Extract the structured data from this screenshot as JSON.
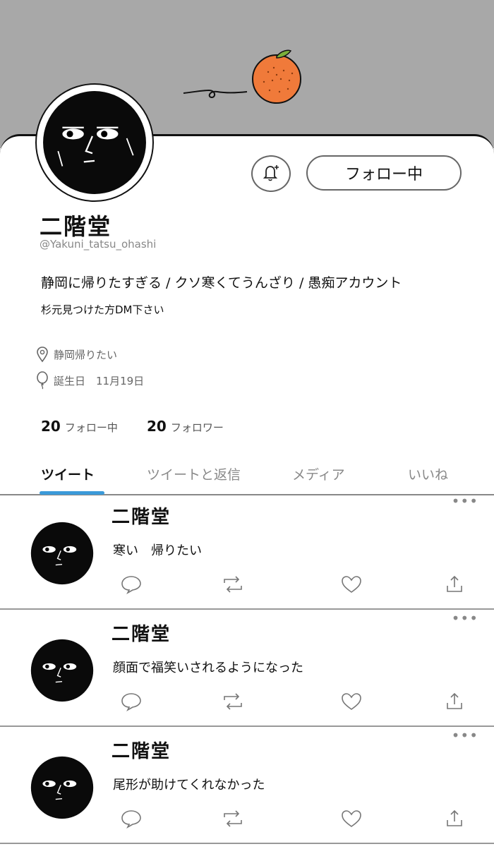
{
  "profile": {
    "name": "二階堂",
    "handle": "@Yakuni_tatsu_ohashi",
    "bio_line1": "静岡に帰りたすぎる / クソ寒くてうんざり / 愚痴アカウント",
    "bio_line2": "杉元見つけた方DM下さい",
    "location": "静岡帰りたい",
    "birthday": "誕生日　11月19日",
    "following_count": "20",
    "following_label": "フォロー中",
    "followers_count": "20",
    "followers_label": "フォロワー"
  },
  "actions": {
    "follow_label": "フォロー中",
    "notify_icon": "bell-plus-icon"
  },
  "tabs": [
    {
      "label": "ツイート",
      "active": true
    },
    {
      "label": "ツイートと返信",
      "active": false
    },
    {
      "label": "メディア",
      "active": false
    },
    {
      "label": "いいね",
      "active": false
    }
  ],
  "tweets": [
    {
      "name": "二階堂",
      "text": "寒い　帰りたい"
    },
    {
      "name": "二階堂",
      "text": "顔面で福笑いされるようになった"
    },
    {
      "name": "二階堂",
      "text": "尾形が助けてくれなかった"
    }
  ],
  "icons": {
    "reply": "speech-bubble-icon",
    "retweet": "retweet-icon",
    "like": "heart-icon",
    "share": "share-icon",
    "more": "more-dots-icon",
    "location": "location-pin-icon",
    "birthday": "balloon-icon"
  },
  "colors": {
    "banner": "#a8a8a8",
    "accent": "#3b9ad9",
    "orange": "#f07a3a"
  }
}
